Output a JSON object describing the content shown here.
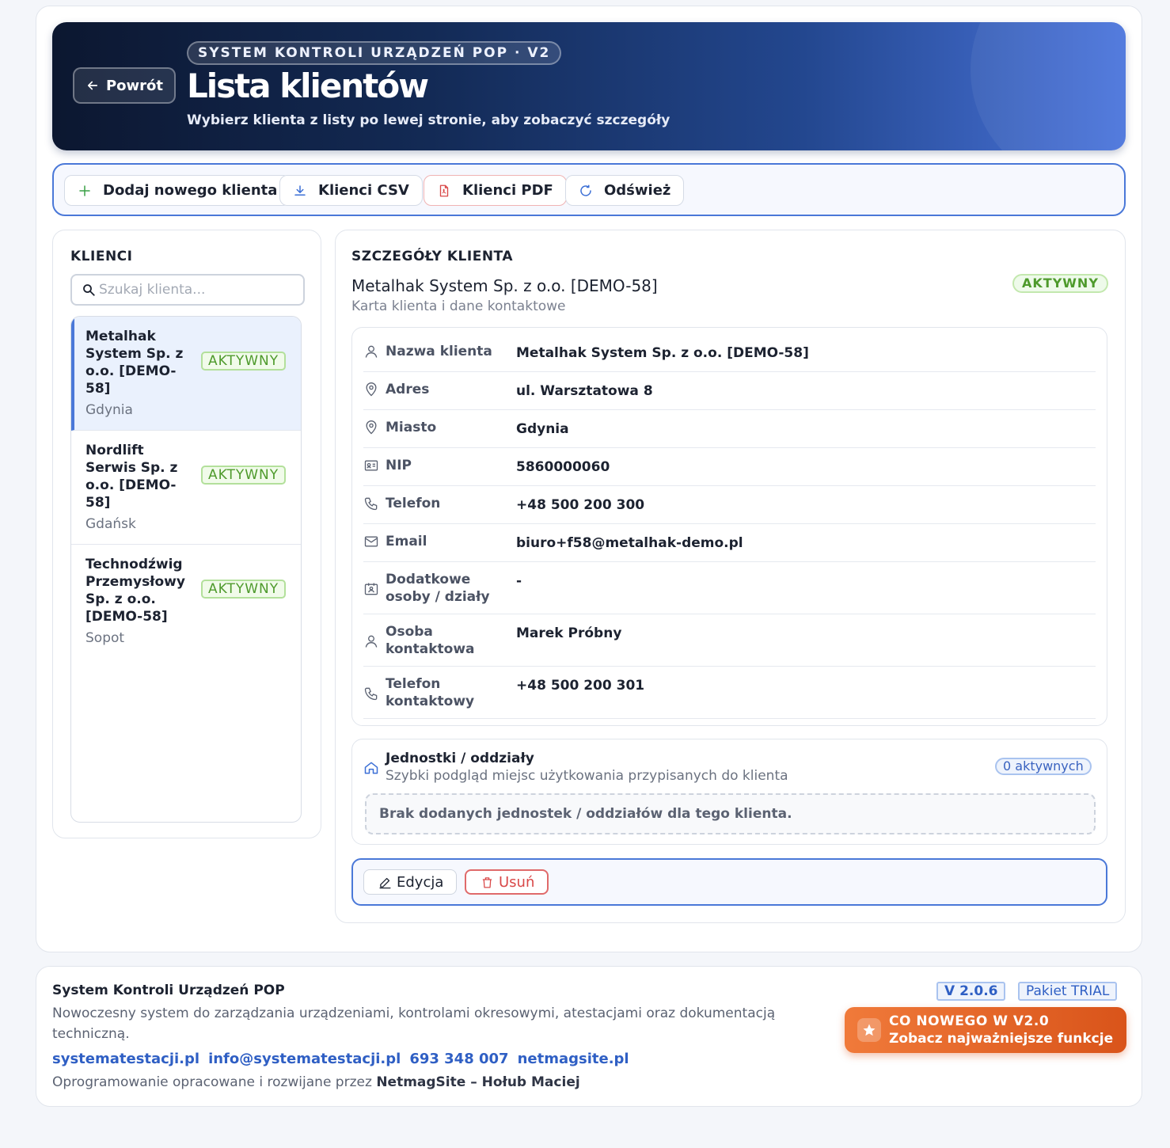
{
  "header": {
    "back_label": "Powrót",
    "system_chip": "SYSTEM KONTROLI URZĄDZEŃ POP · V2",
    "title": "Lista klientów",
    "subtitle": "Wybierz klienta z listy po lewej stronie, aby zobaczyć szczegóły"
  },
  "toolbar": {
    "add_label": "Dodaj nowego klienta",
    "csv_label": "Klienci CSV",
    "pdf_label": "Klienci PDF",
    "refresh_label": "Odśwież"
  },
  "sidebar": {
    "title": "KLIENCI",
    "search_placeholder": "Szukaj klienta...",
    "clients": [
      {
        "name": "Metalhak System Sp. z o.o. [DEMO-58]",
        "city": "Gdynia",
        "status": "AKTYWNY",
        "selected": true
      },
      {
        "name": "Nordlift Serwis Sp. z o.o. [DEMO-58]",
        "city": "Gdańsk",
        "status": "AKTYWNY",
        "selected": false
      },
      {
        "name": "Technodźwig Przemysłowy Sp. z o.o. [DEMO-58]",
        "city": "Sopot",
        "status": "AKTYWNY",
        "selected": false
      }
    ]
  },
  "details": {
    "title": "SZCZEGÓŁY KLIENTA",
    "client_name": "Metalhak System Sp. z o.o. [DEMO-58]",
    "subtitle": "Karta klienta i dane kontaktowe",
    "status": "AKTYWNY",
    "fields": [
      {
        "icon": "user-icon",
        "label": "Nazwa klienta",
        "value": "Metalhak System Sp. z o.o. [DEMO-58]"
      },
      {
        "icon": "map-pin-icon",
        "label": "Adres",
        "value": "ul. Warsztatowa 8"
      },
      {
        "icon": "map-pin-icon",
        "label": "Miasto",
        "value": "Gdynia"
      },
      {
        "icon": "id-card-icon",
        "label": "NIP",
        "value": "5860000060"
      },
      {
        "icon": "phone-icon",
        "label": "Telefon",
        "value": "+48 500 200 300"
      },
      {
        "icon": "mail-icon",
        "label": "Email",
        "value": "biuro+f58@metalhak-demo.pl"
      },
      {
        "icon": "contact-card-icon",
        "label": "Dodatkowe osoby / działy",
        "value": "-"
      },
      {
        "icon": "user-icon",
        "label": "Osoba kontaktowa",
        "value": "Marek Próbny"
      },
      {
        "icon": "phone-icon",
        "label": "Telefon kontaktowy",
        "value": "+48 500 200 301"
      }
    ],
    "units": {
      "title": "Jednostki / oddziały",
      "subtitle": "Szybki podgląd miejsc użytkowania przypisanych do klienta",
      "count_label": "0 aktywnych",
      "empty_text": "Brak dodanych jednostek / oddziałów dla tego klienta."
    },
    "actions": {
      "edit_label": "Edycja",
      "delete_label": "Usuń"
    }
  },
  "footer": {
    "title": "System Kontroli Urządzeń POP",
    "description": "Nowoczesny system do zarządzania urządzeniami, kontrolami okresowymi, atestacjami oraz dokumentacją techniczną.",
    "links": [
      "systematestacji.pl",
      "info@systematestacji.pl",
      "693 348 007",
      "netmagsite.pl"
    ],
    "credit_prefix": "Oprogramowanie opracowane i rozwijane przez",
    "credit_name": "NetmagSite – Hołub Maciej",
    "version": "V 2.0.6",
    "plan": "Pakiet TRIAL",
    "whats_new_title": "CO NOWEGO W V2.0",
    "whats_new_sub": "Zobacz najważniejsze funkcje"
  },
  "colors": {
    "accent": "#4a78d8",
    "active_green": "#4e9a2c",
    "danger": "#d94848",
    "orange": "#e8652a"
  }
}
